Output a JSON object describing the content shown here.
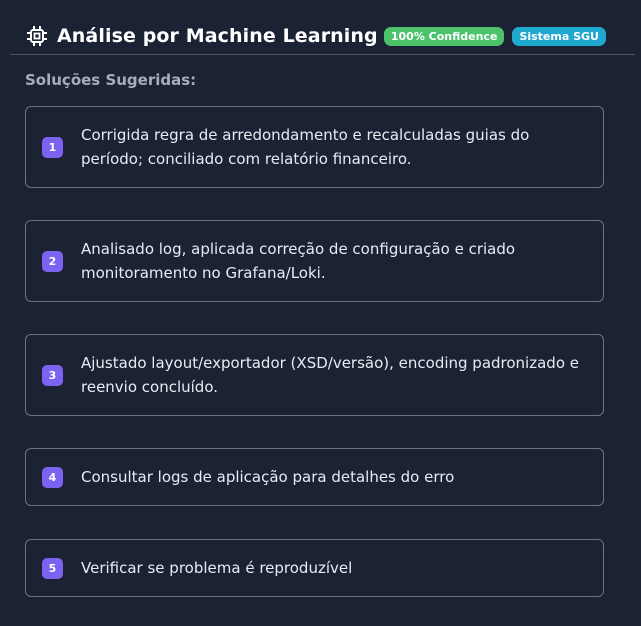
{
  "header": {
    "title": "Análise por Machine Learning",
    "icon": "cpu-chip-icon",
    "badges": [
      {
        "label": "100% Confidence",
        "color": "#4cc36b"
      },
      {
        "label": "Sistema SGU",
        "color": "#20a9cf"
      }
    ]
  },
  "section": {
    "title": "Soluções Sugeridas:"
  },
  "solutions": [
    {
      "number": "1",
      "text": "Corrigida regra de arredondamento e recalculadas guias do período; conciliado com relatório financeiro."
    },
    {
      "number": "2",
      "text": "Analisado log, aplicada correção de configuração e criado monitoramento no Grafana/Loki."
    },
    {
      "number": "3",
      "text": "Ajustado layout/exportador (XSD/versão), encoding padronizado e reenvio concluído."
    },
    {
      "number": "4",
      "text": "Consultar logs de aplicação para detalhes do erro"
    },
    {
      "number": "5",
      "text": "Verificar se problema é reproduzível"
    }
  ],
  "colors": {
    "background": "#1b2233",
    "number_badge": "#7b62f0",
    "card_border": "#6b7282"
  }
}
